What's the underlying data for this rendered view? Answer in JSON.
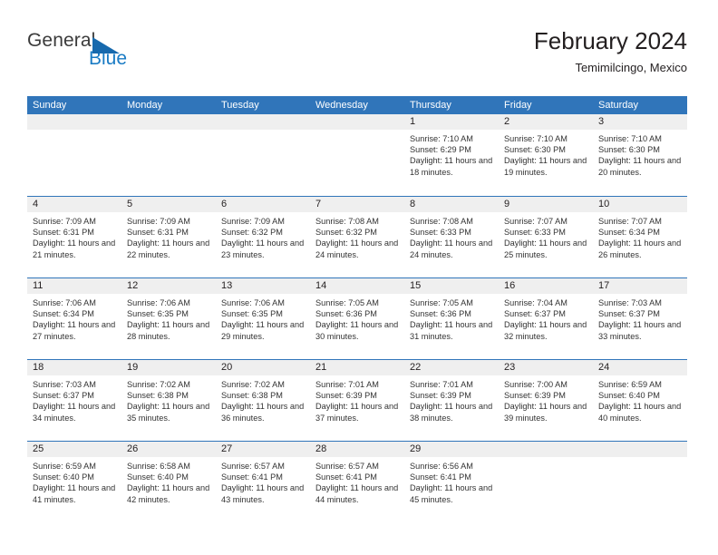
{
  "brand": {
    "name_top": "General",
    "name_bottom": "Blue",
    "triangle_icon": "blue-triangle-icon",
    "color_top": "#3b3b3b",
    "color_bottom": "#1a7bc4"
  },
  "header": {
    "title": "February 2024",
    "subtitle": "Temimilcingo, Mexico"
  },
  "colors": {
    "header_blue": "#3075ba",
    "day_strip_gray": "#efefef",
    "text": "#231f20",
    "body_text": "#333333"
  },
  "calendar": {
    "weekdays": [
      "Sunday",
      "Monday",
      "Tuesday",
      "Wednesday",
      "Thursday",
      "Friday",
      "Saturday"
    ],
    "weeks": [
      [
        {
          "day": "",
          "empty": true
        },
        {
          "day": "",
          "empty": true
        },
        {
          "day": "",
          "empty": true
        },
        {
          "day": "",
          "empty": true
        },
        {
          "day": "1",
          "sunrise": "Sunrise: 7:10 AM",
          "sunset": "Sunset: 6:29 PM",
          "daylight": "Daylight: 11 hours and 18 minutes."
        },
        {
          "day": "2",
          "sunrise": "Sunrise: 7:10 AM",
          "sunset": "Sunset: 6:30 PM",
          "daylight": "Daylight: 11 hours and 19 minutes."
        },
        {
          "day": "3",
          "sunrise": "Sunrise: 7:10 AM",
          "sunset": "Sunset: 6:30 PM",
          "daylight": "Daylight: 11 hours and 20 minutes."
        }
      ],
      [
        {
          "day": "4",
          "sunrise": "Sunrise: 7:09 AM",
          "sunset": "Sunset: 6:31 PM",
          "daylight": "Daylight: 11 hours and 21 minutes."
        },
        {
          "day": "5",
          "sunrise": "Sunrise: 7:09 AM",
          "sunset": "Sunset: 6:31 PM",
          "daylight": "Daylight: 11 hours and 22 minutes."
        },
        {
          "day": "6",
          "sunrise": "Sunrise: 7:09 AM",
          "sunset": "Sunset: 6:32 PM",
          "daylight": "Daylight: 11 hours and 23 minutes."
        },
        {
          "day": "7",
          "sunrise": "Sunrise: 7:08 AM",
          "sunset": "Sunset: 6:32 PM",
          "daylight": "Daylight: 11 hours and 24 minutes."
        },
        {
          "day": "8",
          "sunrise": "Sunrise: 7:08 AM",
          "sunset": "Sunset: 6:33 PM",
          "daylight": "Daylight: 11 hours and 24 minutes."
        },
        {
          "day": "9",
          "sunrise": "Sunrise: 7:07 AM",
          "sunset": "Sunset: 6:33 PM",
          "daylight": "Daylight: 11 hours and 25 minutes."
        },
        {
          "day": "10",
          "sunrise": "Sunrise: 7:07 AM",
          "sunset": "Sunset: 6:34 PM",
          "daylight": "Daylight: 11 hours and 26 minutes."
        }
      ],
      [
        {
          "day": "11",
          "sunrise": "Sunrise: 7:06 AM",
          "sunset": "Sunset: 6:34 PM",
          "daylight": "Daylight: 11 hours and 27 minutes."
        },
        {
          "day": "12",
          "sunrise": "Sunrise: 7:06 AM",
          "sunset": "Sunset: 6:35 PM",
          "daylight": "Daylight: 11 hours and 28 minutes."
        },
        {
          "day": "13",
          "sunrise": "Sunrise: 7:06 AM",
          "sunset": "Sunset: 6:35 PM",
          "daylight": "Daylight: 11 hours and 29 minutes."
        },
        {
          "day": "14",
          "sunrise": "Sunrise: 7:05 AM",
          "sunset": "Sunset: 6:36 PM",
          "daylight": "Daylight: 11 hours and 30 minutes."
        },
        {
          "day": "15",
          "sunrise": "Sunrise: 7:05 AM",
          "sunset": "Sunset: 6:36 PM",
          "daylight": "Daylight: 11 hours and 31 minutes."
        },
        {
          "day": "16",
          "sunrise": "Sunrise: 7:04 AM",
          "sunset": "Sunset: 6:37 PM",
          "daylight": "Daylight: 11 hours and 32 minutes."
        },
        {
          "day": "17",
          "sunrise": "Sunrise: 7:03 AM",
          "sunset": "Sunset: 6:37 PM",
          "daylight": "Daylight: 11 hours and 33 minutes."
        }
      ],
      [
        {
          "day": "18",
          "sunrise": "Sunrise: 7:03 AM",
          "sunset": "Sunset: 6:37 PM",
          "daylight": "Daylight: 11 hours and 34 minutes."
        },
        {
          "day": "19",
          "sunrise": "Sunrise: 7:02 AM",
          "sunset": "Sunset: 6:38 PM",
          "daylight": "Daylight: 11 hours and 35 minutes."
        },
        {
          "day": "20",
          "sunrise": "Sunrise: 7:02 AM",
          "sunset": "Sunset: 6:38 PM",
          "daylight": "Daylight: 11 hours and 36 minutes."
        },
        {
          "day": "21",
          "sunrise": "Sunrise: 7:01 AM",
          "sunset": "Sunset: 6:39 PM",
          "daylight": "Daylight: 11 hours and 37 minutes."
        },
        {
          "day": "22",
          "sunrise": "Sunrise: 7:01 AM",
          "sunset": "Sunset: 6:39 PM",
          "daylight": "Daylight: 11 hours and 38 minutes."
        },
        {
          "day": "23",
          "sunrise": "Sunrise: 7:00 AM",
          "sunset": "Sunset: 6:39 PM",
          "daylight": "Daylight: 11 hours and 39 minutes."
        },
        {
          "day": "24",
          "sunrise": "Sunrise: 6:59 AM",
          "sunset": "Sunset: 6:40 PM",
          "daylight": "Daylight: 11 hours and 40 minutes."
        }
      ],
      [
        {
          "day": "25",
          "sunrise": "Sunrise: 6:59 AM",
          "sunset": "Sunset: 6:40 PM",
          "daylight": "Daylight: 11 hours and 41 minutes."
        },
        {
          "day": "26",
          "sunrise": "Sunrise: 6:58 AM",
          "sunset": "Sunset: 6:40 PM",
          "daylight": "Daylight: 11 hours and 42 minutes."
        },
        {
          "day": "27",
          "sunrise": "Sunrise: 6:57 AM",
          "sunset": "Sunset: 6:41 PM",
          "daylight": "Daylight: 11 hours and 43 minutes."
        },
        {
          "day": "28",
          "sunrise": "Sunrise: 6:57 AM",
          "sunset": "Sunset: 6:41 PM",
          "daylight": "Daylight: 11 hours and 44 minutes."
        },
        {
          "day": "29",
          "sunrise": "Sunrise: 6:56 AM",
          "sunset": "Sunset: 6:41 PM",
          "daylight": "Daylight: 11 hours and 45 minutes."
        },
        {
          "day": "",
          "empty": true
        },
        {
          "day": "",
          "empty": true
        }
      ]
    ]
  }
}
